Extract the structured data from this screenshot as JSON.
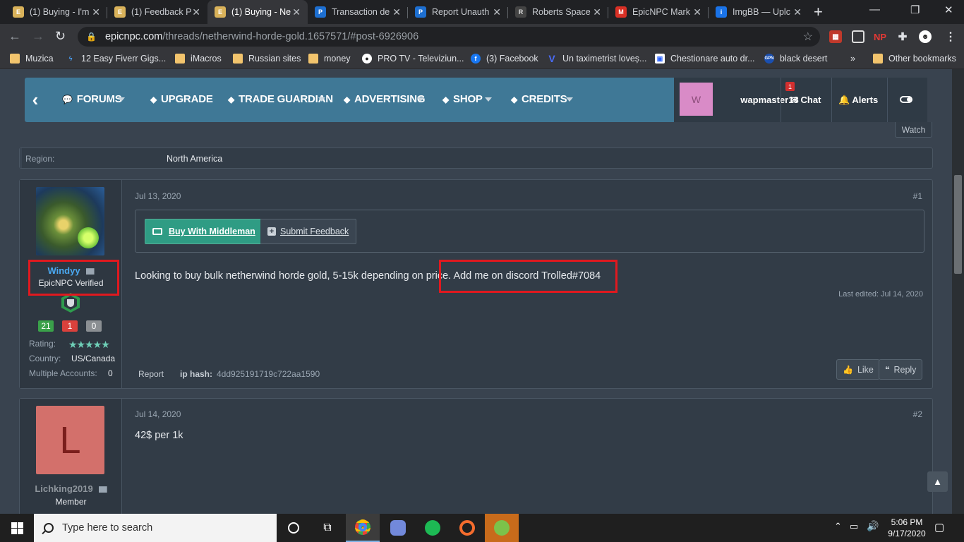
{
  "browser": {
    "tabs": [
      {
        "title": "(1) Buying - I'm",
        "icon": "epicnpc-favicon",
        "color": "#d9b25a"
      },
      {
        "title": "(1) Feedback P",
        "icon": "epicnpc-favicon",
        "color": "#d9b25a"
      },
      {
        "title": "(1) Buying - Ne",
        "icon": "epicnpc-favicon",
        "color": "#d9b25a",
        "active": true
      },
      {
        "title": "Transaction de",
        "icon": "paypal-favicon",
        "color": "#1d6fd1"
      },
      {
        "title": "Report Unauth",
        "icon": "paypal-favicon",
        "color": "#1d6fd1"
      },
      {
        "title": "Roberts Space",
        "icon": "rsi-favicon",
        "color": "#dddddd"
      },
      {
        "title": "EpicNPC Mark",
        "icon": "gmail-favicon",
        "color": "#d93025"
      },
      {
        "title": "ImgBB — Uplc",
        "icon": "imgbb-favicon",
        "color": "#1a73e8"
      }
    ],
    "url_domain": "epicnpc.com",
    "url_path": "/threads/netherwind-horde-gold.1657571/#post-6926906",
    "bookmarks": [
      {
        "label": "Muzica",
        "icon": "folder-icon"
      },
      {
        "label": "12 Easy Fiverr Gigs...",
        "icon": "bolt-icon"
      },
      {
        "label": "iMacros",
        "icon": "folder-icon"
      },
      {
        "label": "Russian sites",
        "icon": "folder-icon"
      },
      {
        "label": "money",
        "icon": "folder-icon"
      },
      {
        "label": "PRO TV - Televiziun...",
        "icon": "globe-icon"
      },
      {
        "label": "(3) Facebook",
        "icon": "facebook-icon"
      },
      {
        "label": "Un taximetrist loveș...",
        "icon": "v-icon"
      },
      {
        "label": "Chestionare auto dr...",
        "icon": "car-icon"
      },
      {
        "label": "black desert",
        "icon": "gpn-icon"
      },
      {
        "label": "»",
        "icon": ""
      },
      {
        "label": "Other bookmarks",
        "icon": "folder-icon"
      }
    ]
  },
  "forum_nav": {
    "items": [
      {
        "label": "FORUMS",
        "icon": "comments-icon",
        "has_caret": true
      },
      {
        "label": "UPGRADE",
        "icon": "tag-icon",
        "has_caret": false
      },
      {
        "label": "TRADE GUARDIAN",
        "icon": "tag-icon",
        "has_caret": true
      },
      {
        "label": "ADVERTISING",
        "icon": "tag-icon",
        "has_caret": true
      },
      {
        "label": "SHOP",
        "icon": "tag-icon",
        "has_caret": true
      },
      {
        "label": "CREDITS",
        "icon": "tag-icon",
        "has_caret": true
      }
    ],
    "user": {
      "avatar_letter": "W",
      "username": "wapmaster13"
    },
    "chat_label": "Chat",
    "chat_badge": "1",
    "alerts_label": "Alerts"
  },
  "watch_label": "Watch",
  "region": {
    "label": "Region:",
    "value": "North America"
  },
  "posts": [
    {
      "username": "Windyy",
      "username_color": "#4aa8f0",
      "user_title": "EpicNPC Verified",
      "counts": [
        {
          "value": "21",
          "color": "#3aa14a"
        },
        {
          "value": "1",
          "color": "#d9413c"
        },
        {
          "value": "0",
          "color": "#8b8f93"
        }
      ],
      "rating_label": "Rating:",
      "rating_stars": 5,
      "country_label": "Country:",
      "country_value": "US/Canada",
      "multi_label": "Multiple Accounts:",
      "multi_value": "0",
      "date": "Jul 13, 2020",
      "number": "#1",
      "buy_middleman": "Buy With Middleman",
      "submit_feedback": "Submit Feedback",
      "body_before": "Looking to buy bulk netherwind horde gold, 5-15k depending on price. ",
      "body_highlight": "Add me on discord Trolled#7084",
      "last_edited": "Last edited: Jul 14, 2020",
      "report": "Report",
      "ip_label": "ip hash:",
      "ip_value": "4dd925191719c722aa1590",
      "like": "Like",
      "reply": "Reply"
    },
    {
      "username": "Lichking2019",
      "username_color": "#8e959c",
      "avatar_letter": "L",
      "user_title": "Member",
      "date": "Jul 14, 2020",
      "number": "#2",
      "body": "42$ per 1k"
    }
  ],
  "taskbar": {
    "search_placeholder": "Type here to search",
    "time": "5:06 PM",
    "date": "9/17/2020"
  }
}
